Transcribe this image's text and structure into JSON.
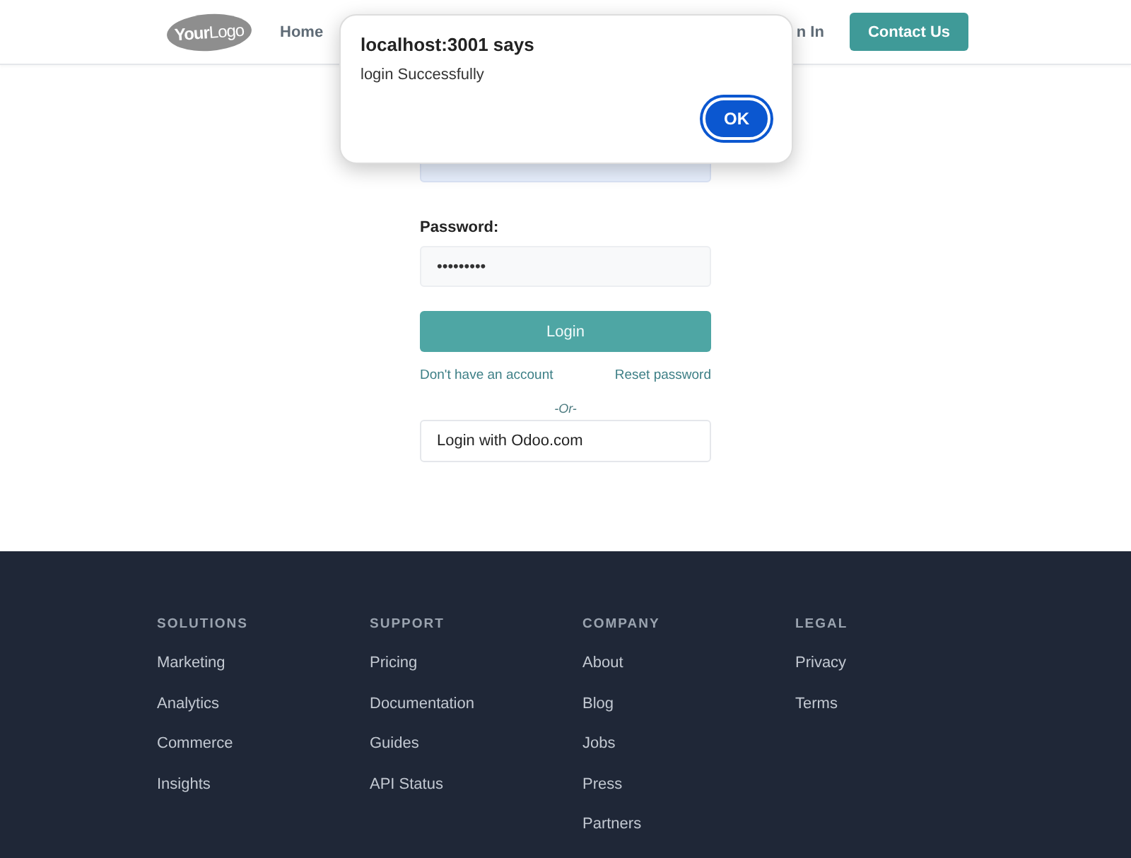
{
  "header": {
    "logo": {
      "bold": "Your",
      "rest": "Logo"
    },
    "nav_left": [
      "Home"
    ],
    "nav_right": [
      "n In"
    ],
    "cta": "Contact Us"
  },
  "form": {
    "email": {
      "autofilled": true
    },
    "password": {
      "label": "Password:",
      "value": "•••••••••"
    },
    "submit": "Login",
    "links": [
      "Don't have an account",
      "Reset password"
    ],
    "divider": "-Or-",
    "oauth": "Login with Odoo.com"
  },
  "footer": {
    "columns": [
      {
        "heading": "SOLUTIONS",
        "links": [
          "Marketing",
          "Analytics",
          "Commerce",
          "Insights"
        ]
      },
      {
        "heading": "SUPPORT",
        "links": [
          "Pricing",
          "Documentation",
          "Guides",
          "API Status"
        ]
      },
      {
        "heading": "COMPANY",
        "links": [
          "About",
          "Blog",
          "Jobs",
          "Press",
          "Partners"
        ]
      },
      {
        "heading": "LEGAL",
        "links": [
          "Privacy",
          "Terms"
        ]
      }
    ]
  },
  "dialog": {
    "title": "localhost:3001 says",
    "message": "login Successfully",
    "button": "OK"
  }
}
